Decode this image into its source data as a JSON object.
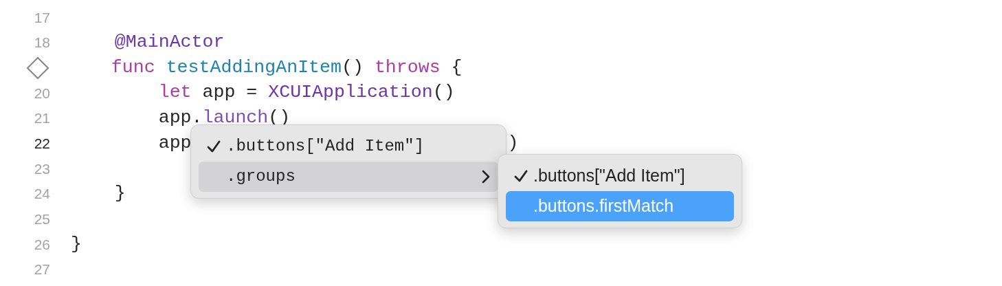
{
  "editor": {
    "lines": [
      {
        "number": "17",
        "current": false
      },
      {
        "number": "18",
        "current": false,
        "tokens": [
          {
            "text": "    @MainActor",
            "kind": "attribute"
          }
        ]
      },
      {
        "test_marker": true,
        "tokens": [
          {
            "text": "    func",
            "kind": "keyword"
          },
          {
            "text": " testAddingAnItem",
            "kind": "function"
          },
          {
            "text": "() "
          },
          {
            "text": "throws",
            "kind": "keyword"
          },
          {
            "text": " {"
          }
        ]
      },
      {
        "number": "20",
        "current": false,
        "tokens": [
          {
            "text": "        let",
            "kind": "keyword"
          },
          {
            "text": " app = "
          },
          {
            "text": "XCUIApplication",
            "kind": "type"
          },
          {
            "text": "()"
          }
        ]
      },
      {
        "number": "21",
        "current": false,
        "tokens": [
          {
            "text": "        app."
          },
          {
            "text": "launch",
            "kind": "method"
          },
          {
            "text": "()"
          }
        ]
      },
      {
        "number": "22",
        "current": true,
        "tokens": [
          {
            "text": "        app"
          },
          {
            "text": ")",
            "kind": "tail"
          }
        ]
      },
      {
        "number": "23",
        "current": false
      },
      {
        "number": "24",
        "current": false,
        "tokens": [
          {
            "text": "    }"
          }
        ]
      },
      {
        "number": "25",
        "current": false
      },
      {
        "number": "26",
        "current": false,
        "tokens": [
          {
            "text": "}"
          }
        ]
      },
      {
        "number": "27",
        "current": false
      }
    ]
  },
  "menus": [
    {
      "kind": "code",
      "items": [
        {
          "label": ".buttons[\"Add Item\"]",
          "checked": true,
          "selected": false,
          "submenu": false
        },
        {
          "label": ".groups",
          "checked": false,
          "selected": false,
          "hovered": true,
          "submenu": true
        }
      ]
    },
    {
      "kind": "text",
      "items": [
        {
          "label": ".buttons[\"Add Item\"]",
          "checked": true,
          "selected": false,
          "submenu": false
        },
        {
          "label": ".buttons.firstMatch",
          "checked": false,
          "selected": true,
          "submenu": false
        }
      ]
    }
  ]
}
